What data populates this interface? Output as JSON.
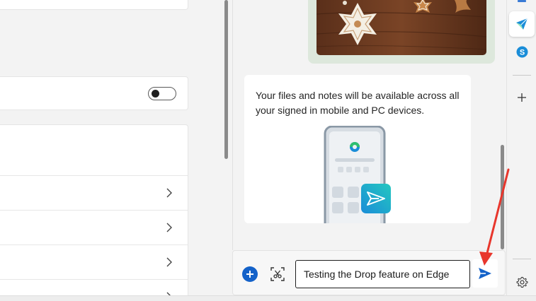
{
  "drop": {
    "note_text": "Your files and notes will be available across all your signed in mobile and PC devices.",
    "message_value": "Testing the Drop feature on Edge",
    "message_placeholder": ""
  },
  "colors": {
    "accent": "#1462c9",
    "annotation_arrow": "#e8362c",
    "send_gradient_start": "#1a8dd8",
    "send_gradient_end": "#24c7c0"
  },
  "icons": {
    "composer": [
      "add-icon",
      "screen-capture-icon",
      "send-icon"
    ],
    "sidebar": [
      "drop-icon",
      "skype-icon",
      "add-icon",
      "settings-icon"
    ],
    "list": [
      "chevron-right-icon"
    ]
  },
  "settings": {
    "toggle_on": false
  }
}
